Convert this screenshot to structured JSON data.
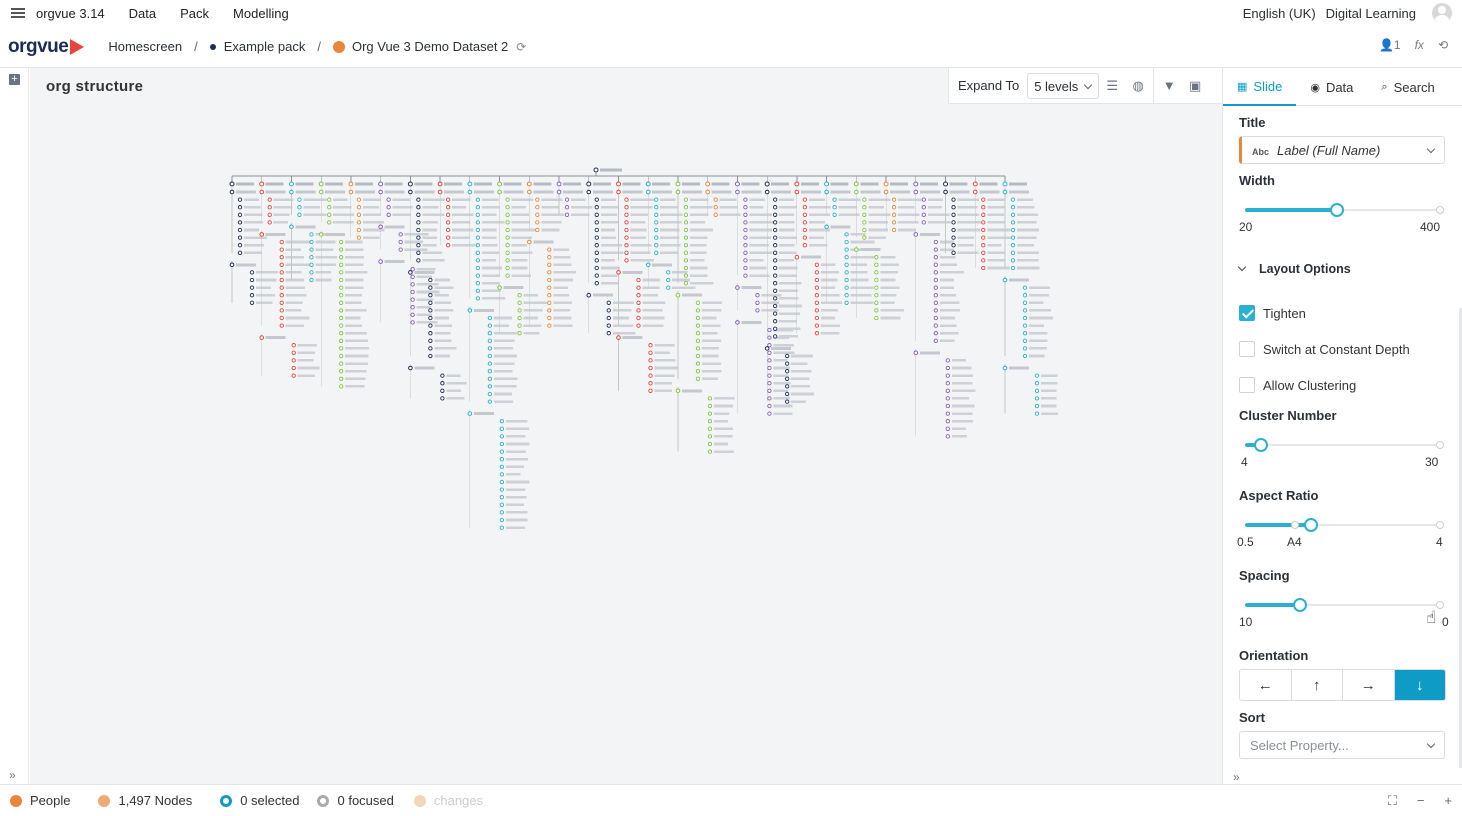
{
  "app": {
    "name": "orgvue 3.14",
    "menus": [
      "Data",
      "Pack",
      "Modelling"
    ],
    "language": "English (UK)",
    "learning": "Digital Learning"
  },
  "logo_text": "orgvue",
  "breadcrumb": [
    "Homescreen",
    "Example pack",
    "Org Vue 3 Demo Dataset 2"
  ],
  "header_right": {
    "count": "1",
    "fx": "fx"
  },
  "canvas": {
    "title": "org structure"
  },
  "toolbar": {
    "expand_label": "Expand To",
    "levels": "5 levels"
  },
  "panel": {
    "tabs": [
      "Slide",
      "Data",
      "Search"
    ],
    "title_label": "Title",
    "title_type": "Abc",
    "title_value": "Label (Full Name)",
    "width_label": "Width",
    "width": {
      "min": "20",
      "max": "400",
      "value_fraction": 0.47
    },
    "layout_label": "Layout Options",
    "options": [
      {
        "label": "Tighten",
        "checked": true
      },
      {
        "label": "Switch at Constant Depth",
        "checked": false
      },
      {
        "label": "Allow Clustering",
        "checked": false
      }
    ],
    "cluster_label": "Cluster Number",
    "cluster": {
      "min": "4",
      "max": "30",
      "value_fraction": 0.08
    },
    "aspect_label": "Aspect Ratio",
    "aspect": {
      "min": "0.5",
      "mid": "A4",
      "max": "4",
      "value_fraction": 0.34
    },
    "spacing_label": "Spacing",
    "spacing": {
      "min": "10",
      "max": "0",
      "value_fraction": 0.28
    },
    "orientation_label": "Orientation",
    "orientation": [
      "←",
      "↑",
      "→",
      "↓"
    ],
    "orientation_selected": 3,
    "sort_label": "Sort",
    "sort_placeholder": "Select Property..."
  },
  "status": {
    "entity": "People",
    "nodes": "1,497 Nodes",
    "selected": "0 selected",
    "focused": "0 focused",
    "changes": "changes"
  },
  "colors": {
    "accent": "#0e9cc7",
    "brand_red": "#e8453c",
    "brand_navy": "#1d2b57",
    "orange": "#e8873c"
  }
}
